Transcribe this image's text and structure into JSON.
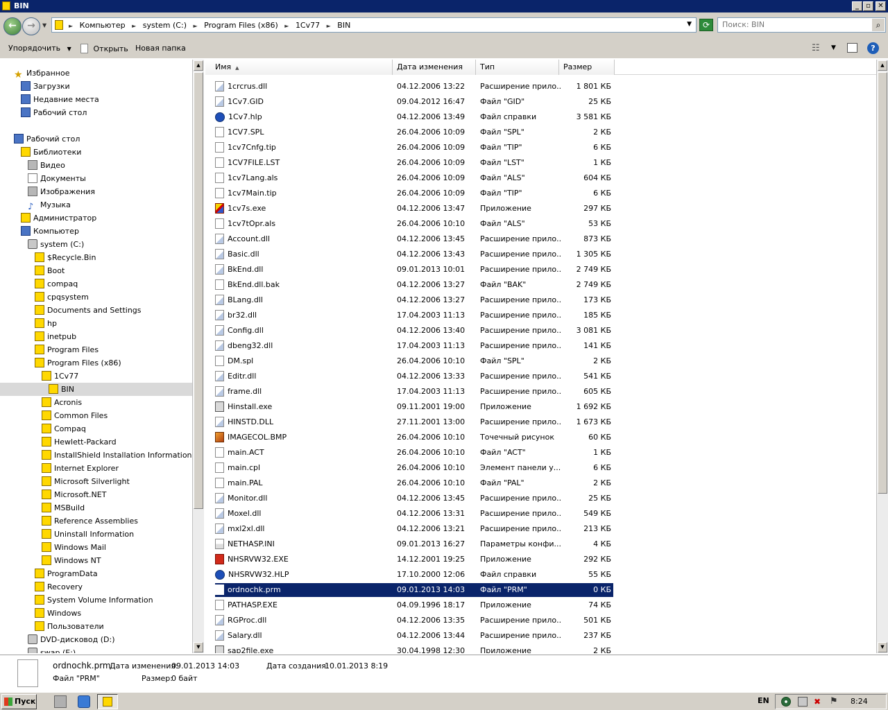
{
  "window": {
    "title": "BIN",
    "min": "_",
    "max": "▫",
    "close": "✕"
  },
  "address": {
    "crumbs": [
      "Компьютер",
      "system (C:)",
      "Program Files (x86)",
      "1Cv77",
      "BIN"
    ],
    "search_placeholder": "Поиск: BIN"
  },
  "toolbar": {
    "organize": "Упорядочить",
    "open": "Открыть",
    "new_folder": "Новая папка"
  },
  "nav": {
    "items": [
      {
        "label": "Избранное",
        "icon": "star-icon"
      },
      {
        "label": "Загрузки",
        "icon": "downloads-icon"
      },
      {
        "label": "Недавние места",
        "icon": "recent-places-icon"
      },
      {
        "label": "Рабочий стол",
        "icon": "desktop-icon"
      },
      {
        "label": "Рабочий стол",
        "icon": "desktop-icon"
      },
      {
        "label": "Библиотеки",
        "icon": "libraries-icon"
      },
      {
        "label": "Видео",
        "icon": "video-icon"
      },
      {
        "label": "Документы",
        "icon": "documents-icon"
      },
      {
        "label": "Изображения",
        "icon": "pictures-icon"
      },
      {
        "label": "Музыка",
        "icon": "music-icon"
      },
      {
        "label": "Администратор",
        "icon": "user-folder-icon"
      },
      {
        "label": "Компьютер",
        "icon": "computer-icon"
      },
      {
        "label": "system (C:)",
        "icon": "drive-icon"
      },
      {
        "label": "$Recycle.Bin",
        "icon": "folder-icon"
      },
      {
        "label": "Boot",
        "icon": "folder-icon"
      },
      {
        "label": "compaq",
        "icon": "folder-icon"
      },
      {
        "label": "cpqsystem",
        "icon": "folder-icon"
      },
      {
        "label": "Documents and Settings",
        "icon": "folder-icon"
      },
      {
        "label": "hp",
        "icon": "folder-icon"
      },
      {
        "label": "inetpub",
        "icon": "folder-icon"
      },
      {
        "label": "Program Files",
        "icon": "folder-icon"
      },
      {
        "label": "Program Files (x86)",
        "icon": "folder-icon"
      },
      {
        "label": "1Cv77",
        "icon": "folder-icon"
      },
      {
        "label": "BIN",
        "icon": "folder-icon"
      },
      {
        "label": "Acronis",
        "icon": "folder-icon"
      },
      {
        "label": "Common Files",
        "icon": "folder-icon"
      },
      {
        "label": "Compaq",
        "icon": "folder-icon"
      },
      {
        "label": "Hewlett-Packard",
        "icon": "folder-icon"
      },
      {
        "label": "InstallShield Installation Information",
        "icon": "folder-icon"
      },
      {
        "label": "Internet Explorer",
        "icon": "folder-icon"
      },
      {
        "label": "Microsoft Silverlight",
        "icon": "folder-icon"
      },
      {
        "label": "Microsoft.NET",
        "icon": "folder-icon"
      },
      {
        "label": "MSBuild",
        "icon": "folder-icon"
      },
      {
        "label": "Reference Assemblies",
        "icon": "folder-icon"
      },
      {
        "label": "Uninstall Information",
        "icon": "folder-icon"
      },
      {
        "label": "Windows Mail",
        "icon": "folder-icon"
      },
      {
        "label": "Windows NT",
        "icon": "folder-icon"
      },
      {
        "label": "ProgramData",
        "icon": "folder-icon"
      },
      {
        "label": "Recovery",
        "icon": "folder-icon"
      },
      {
        "label": "System Volume Information",
        "icon": "folder-icon"
      },
      {
        "label": "Windows",
        "icon": "folder-icon"
      },
      {
        "label": "Пользователи",
        "icon": "folder-icon"
      },
      {
        "label": "DVD-дисковод (D:)",
        "icon": "dvd-drive-icon"
      },
      {
        "label": "swap (E:)",
        "icon": "drive-icon"
      }
    ]
  },
  "columns": {
    "name": "Имя",
    "date": "Дата изменения",
    "type": "Тип",
    "size": "Размер"
  },
  "files": [
    {
      "name": "1crcrus.dll",
      "date": "04.12.2006 13:22",
      "type": "Расширение прило...",
      "size": "1 801 КБ",
      "icon": "dll"
    },
    {
      "name": "1Cv7.GID",
      "date": "09.04.2012 16:47",
      "type": "Файл \"GID\"",
      "size": "25 КБ",
      "icon": "dll"
    },
    {
      "name": "1Cv7.hlp",
      "date": "04.12.2006 13:49",
      "type": "Файл справки",
      "size": "3 581 КБ",
      "icon": "help"
    },
    {
      "name": "1CV7.SPL",
      "date": "26.04.2006 10:09",
      "type": "Файл \"SPL\"",
      "size": "2 КБ",
      "icon": "file"
    },
    {
      "name": "1cv7Cnfg.tip",
      "date": "26.04.2006 10:09",
      "type": "Файл \"TIP\"",
      "size": "6 КБ",
      "icon": "file"
    },
    {
      "name": "1CV7FILE.LST",
      "date": "26.04.2006 10:09",
      "type": "Файл \"LST\"",
      "size": "1 КБ",
      "icon": "file"
    },
    {
      "name": "1cv7Lang.als",
      "date": "26.04.2006 10:09",
      "type": "Файл \"ALS\"",
      "size": "604 КБ",
      "icon": "file"
    },
    {
      "name": "1cv7Main.tip",
      "date": "26.04.2006 10:09",
      "type": "Файл \"TIP\"",
      "size": "6 КБ",
      "icon": "file"
    },
    {
      "name": "1cv7s.exe",
      "date": "04.12.2006 13:47",
      "type": "Приложение",
      "size": "297 КБ",
      "icon": "app1c"
    },
    {
      "name": "1cv7tOpr.als",
      "date": "26.04.2006 10:10",
      "type": "Файл \"ALS\"",
      "size": "53 КБ",
      "icon": "file"
    },
    {
      "name": "Account.dll",
      "date": "04.12.2006 13:45",
      "type": "Расширение прило...",
      "size": "873 КБ",
      "icon": "dll"
    },
    {
      "name": "Basic.dll",
      "date": "04.12.2006 13:43",
      "type": "Расширение прило...",
      "size": "1 305 КБ",
      "icon": "dll"
    },
    {
      "name": "BkEnd.dll",
      "date": "09.01.2013 10:01",
      "type": "Расширение прило...",
      "size": "2 749 КБ",
      "icon": "dll"
    },
    {
      "name": "BkEnd.dll.bak",
      "date": "04.12.2006 13:27",
      "type": "Файл \"BAK\"",
      "size": "2 749 КБ",
      "icon": "file"
    },
    {
      "name": "BLang.dll",
      "date": "04.12.2006 13:27",
      "type": "Расширение прило...",
      "size": "173 КБ",
      "icon": "dll"
    },
    {
      "name": "br32.dll",
      "date": "17.04.2003 11:13",
      "type": "Расширение прило...",
      "size": "185 КБ",
      "icon": "dll"
    },
    {
      "name": "Config.dll",
      "date": "04.12.2006 13:40",
      "type": "Расширение прило...",
      "size": "3 081 КБ",
      "icon": "dll"
    },
    {
      "name": "dbeng32.dll",
      "date": "17.04.2003 11:13",
      "type": "Расширение прило...",
      "size": "141 КБ",
      "icon": "dll"
    },
    {
      "name": "DM.spl",
      "date": "26.04.2006 10:10",
      "type": "Файл \"SPL\"",
      "size": "2 КБ",
      "icon": "file"
    },
    {
      "name": "Editr.dll",
      "date": "04.12.2006 13:33",
      "type": "Расширение прило...",
      "size": "541 КБ",
      "icon": "dll"
    },
    {
      "name": "frame.dll",
      "date": "17.04.2003 11:13",
      "type": "Расширение прило...",
      "size": "605 КБ",
      "icon": "dll"
    },
    {
      "name": "Hinstall.exe",
      "date": "09.11.2001 19:00",
      "type": "Приложение",
      "size": "1 692 КБ",
      "icon": "exe"
    },
    {
      "name": "HINSTD.DLL",
      "date": "27.11.2001 13:00",
      "type": "Расширение прило...",
      "size": "1 673 КБ",
      "icon": "dll"
    },
    {
      "name": "IMAGECOL.BMP",
      "date": "26.04.2006 10:10",
      "type": "Точечный рисунок",
      "size": "60 КБ",
      "icon": "bmp"
    },
    {
      "name": "main.ACT",
      "date": "26.04.2006 10:10",
      "type": "Файл \"ACT\"",
      "size": "1 КБ",
      "icon": "file"
    },
    {
      "name": "main.cpl",
      "date": "26.04.2006 10:10",
      "type": "Элемент панели у...",
      "size": "6 КБ",
      "icon": "file"
    },
    {
      "name": "main.PAL",
      "date": "26.04.2006 10:10",
      "type": "Файл \"PAL\"",
      "size": "2 КБ",
      "icon": "file"
    },
    {
      "name": "Monitor.dll",
      "date": "04.12.2006 13:45",
      "type": "Расширение прило...",
      "size": "25 КБ",
      "icon": "dll"
    },
    {
      "name": "Moxel.dll",
      "date": "04.12.2006 13:31",
      "type": "Расширение прило...",
      "size": "549 КБ",
      "icon": "dll"
    },
    {
      "name": "mxl2xl.dll",
      "date": "04.12.2006 13:21",
      "type": "Расширение прило...",
      "size": "213 КБ",
      "icon": "dll"
    },
    {
      "name": "NETHASP.INI",
      "date": "09.01.2013 16:27",
      "type": "Параметры конфи...",
      "size": "4 КБ",
      "icon": "ini"
    },
    {
      "name": "NHSRVW32.EXE",
      "date": "14.12.2001 19:25",
      "type": "Приложение",
      "size": "292 КБ",
      "icon": "redexe"
    },
    {
      "name": "NHSRVW32.HLP",
      "date": "17.10.2000 12:06",
      "type": "Файл справки",
      "size": "55 КБ",
      "icon": "help"
    },
    {
      "name": "ordnochk.prm",
      "date": "09.01.2013 14:03",
      "type": "Файл \"PRM\"",
      "size": "0 КБ",
      "icon": "file",
      "selected": true
    },
    {
      "name": "PATHASP.EXE",
      "date": "04.09.1996 18:17",
      "type": "Приложение",
      "size": "74 КБ",
      "icon": "file"
    },
    {
      "name": "RGProc.dll",
      "date": "04.12.2006 13:35",
      "type": "Расширение прило...",
      "size": "501 КБ",
      "icon": "dll"
    },
    {
      "name": "Salary.dll",
      "date": "04.12.2006 13:44",
      "type": "Расширение прило...",
      "size": "237 КБ",
      "icon": "dll"
    },
    {
      "name": "sap2file.exe",
      "date": "30.04.1998 12:30",
      "type": "Приложение",
      "size": "2 КБ",
      "icon": "exe"
    }
  ],
  "details": {
    "name": "ordnochk.prm",
    "modified_label": "Дата изменения:",
    "modified": "09.01.2013 14:03",
    "created_label": "Дата создания:",
    "created": "10.01.2013 8:19",
    "type": "Файл \"PRM\"",
    "size_label": "Размер:",
    "size": "0 байт"
  },
  "taskbar": {
    "start": "Пуск",
    "lang": "EN",
    "clock": "8:24"
  }
}
